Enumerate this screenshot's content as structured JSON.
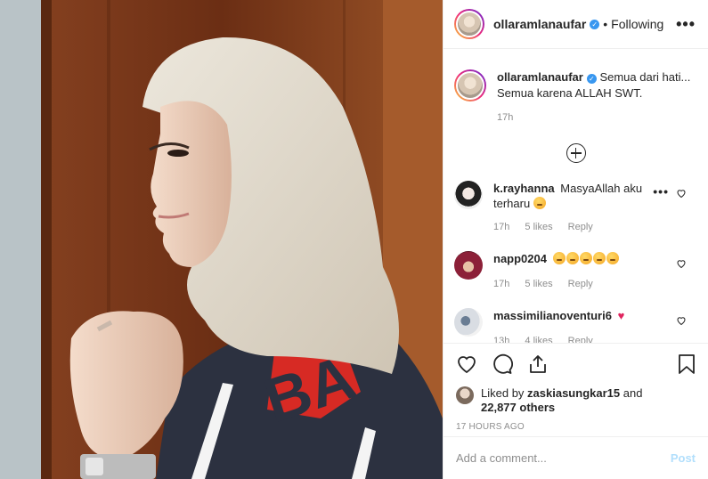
{
  "post": {
    "username": "ollaramlanaufar",
    "follow_dot": "•",
    "follow_label": "Following",
    "more_label": "•••"
  },
  "caption": {
    "username": "ollaramlanaufar",
    "text": "Semua dari hati... Semua karena ALLAH SWT.",
    "time": "17h"
  },
  "comments": [
    {
      "username": "k.rayhanna",
      "text": "MasyaAllah aku terharu",
      "time": "17h",
      "likes": "5 likes",
      "reply": "Reply",
      "emoji_count": 1
    },
    {
      "username": "napp0204",
      "text": "",
      "time": "17h",
      "likes": "5 likes",
      "reply": "Reply",
      "emoji_count": 5
    },
    {
      "username": "massimilianoventuri6",
      "text": "",
      "time": "13h",
      "likes": "4 likes",
      "reply": "Reply",
      "emoji_count": 0
    }
  ],
  "likes": {
    "prefix": "Liked by",
    "user": "zaskiasungkar15",
    "and": "and",
    "others": "22,877 others"
  },
  "timestamp": "17 HOURS AGO",
  "add_comment": {
    "placeholder": "Add a comment...",
    "post_label": "Post"
  },
  "photo": {
    "jacket_text": "BA"
  },
  "colors": {
    "verified": "#3897f0",
    "meta": "#8e8e8e",
    "post_disabled": "#b2dffc",
    "jacket_red": "#d72a24"
  },
  "icons": [
    "heart-icon",
    "comment-icon",
    "share-icon",
    "bookmark-icon",
    "plus-circle-icon",
    "verified-icon"
  ]
}
